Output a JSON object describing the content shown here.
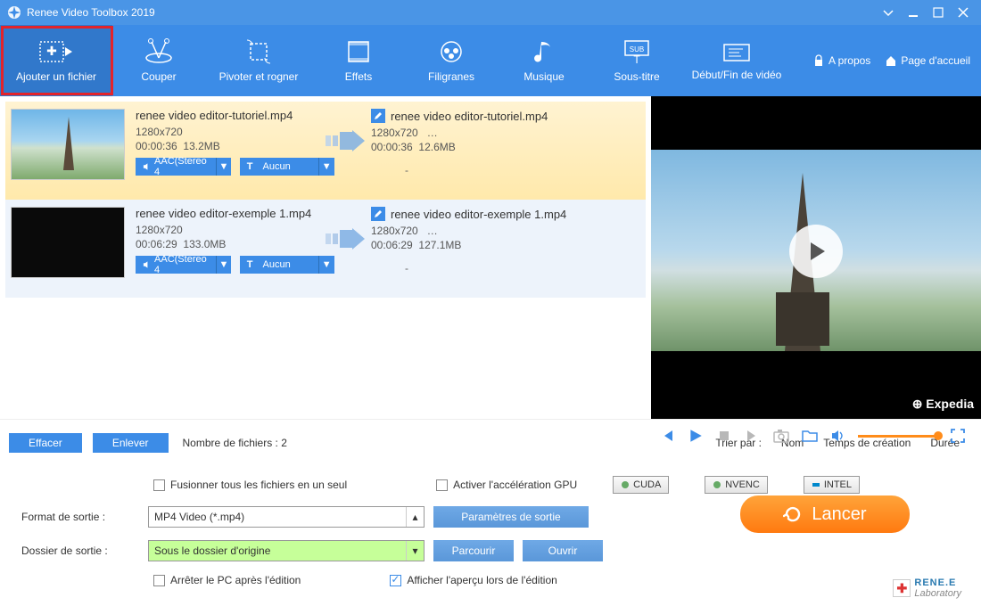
{
  "app": {
    "title": "Renee Video Toolbox 2019"
  },
  "toolbar": {
    "add_file": "Ajouter un fichier",
    "cut": "Couper",
    "rotate_crop": "Pivoter et rogner",
    "effects": "Effets",
    "watermarks": "Filigranes",
    "music": "Musique",
    "subtitle": "Sous-titre",
    "intro_outro": "Début/Fin de vidéo",
    "about": "A propos",
    "homepage": "Page d'accueil"
  },
  "files": [
    {
      "name": "renee video editor-tutoriel.mp4",
      "dim": "1280x720",
      "duration": "00:00:36",
      "size": "13.2MB",
      "audio": "AAC(Stereo 4",
      "sub": "Aucun",
      "out_name": "renee video editor-tutoriel.mp4",
      "out_dim": "1280x720",
      "out_more": "…",
      "out_duration": "00:00:36",
      "out_size": "12.6MB"
    },
    {
      "name": "renee video editor-exemple 1.mp4",
      "dim": "1280x720",
      "duration": "00:06:29",
      "size": "133.0MB",
      "audio": "AAC(Stereo 4",
      "sub": "Aucun",
      "out_name": "renee video editor-exemple 1.mp4",
      "out_dim": "1280x720",
      "out_more": "…",
      "out_duration": "00:06:29",
      "out_size": "127.1MB"
    }
  ],
  "actions": {
    "clear": "Effacer",
    "remove": "Enlever",
    "file_count": "Nombre de fichiers : 2",
    "sort_label": "Trier par :",
    "sort_name": "Nom",
    "sort_created": "Temps de création",
    "sort_duration": "Durée"
  },
  "settings": {
    "merge_all": "Fusionner tous les fichiers en un seul",
    "gpu_accel": "Activer l'accélération GPU",
    "gpu_cuda": "CUDA",
    "gpu_nvenc": "NVENC",
    "gpu_intel": "INTEL",
    "output_format_label": "Format de sortie :",
    "output_format": "MP4 Video (*.mp4)",
    "output_params": "Paramètres de sortie",
    "output_folder_label": "Dossier de sortie :",
    "output_folder": "Sous le dossier d'origine",
    "browse": "Parcourir",
    "open": "Ouvrir",
    "shutdown_after": "Arrêter le PC après l'édition",
    "preview_during": "Afficher l'aperçu lors de l'édition",
    "launch": "Lancer"
  },
  "preview": {
    "brand": "⊕ Expedia"
  },
  "logo": {
    "line1": "RENE.E",
    "line2": "Laboratory"
  }
}
